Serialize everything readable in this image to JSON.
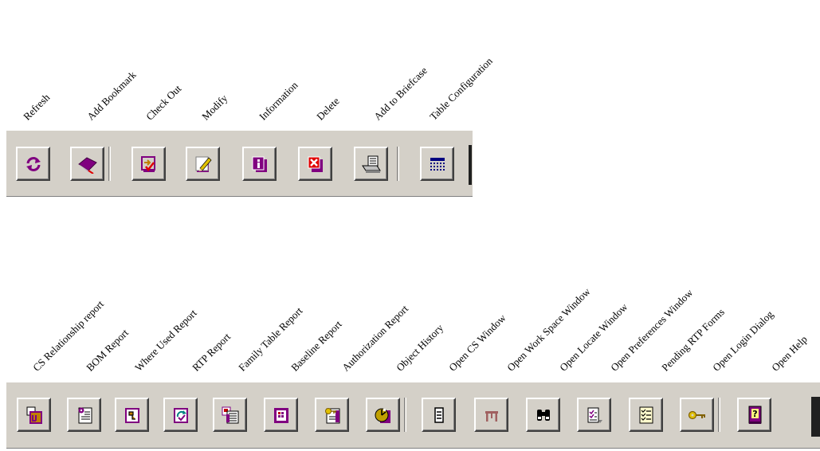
{
  "toolbar1": {
    "labels": [
      "Refresh",
      "Add Bookmark",
      "Check Out",
      "Modify",
      "Information",
      "Delete",
      "Add to Briefcase",
      "Table Configuration"
    ]
  },
  "toolbar2": {
    "labels": [
      "CS Relationship report",
      "BOM Report",
      "Where Used Report",
      "RTP Report",
      "Family Table Report",
      "Baseline Report",
      "Authorization Report",
      "Object History",
      "Open CS Window",
      "Open Work Space Window",
      "Open Locate Window",
      "Open Preferences Window",
      "Pending RTP Forms",
      "Open Login Dialog",
      "Open Help"
    ]
  },
  "colors": {
    "toolbar_bg": "#d4d0c8",
    "accent_purple": "#800080",
    "accent_red": "#e00000"
  },
  "icons": {
    "toolbar1": [
      "refresh-icon",
      "bookmark-book-icon",
      "check-out-icon",
      "modify-pencil-icon",
      "information-icon",
      "delete-icon",
      "briefcase-icon",
      "table-config-icon"
    ],
    "toolbar2": [
      "cs-relationship-icon",
      "bom-report-icon",
      "where-used-icon",
      "rtp-report-icon",
      "family-table-icon",
      "baseline-report-icon",
      "authorization-key-icon",
      "object-history-icon",
      "cs-window-icon",
      "work-space-window-icon",
      "binoculars-icon",
      "preferences-checklist-icon",
      "pending-forms-icon",
      "login-key-icon",
      "help-book-icon"
    ]
  }
}
